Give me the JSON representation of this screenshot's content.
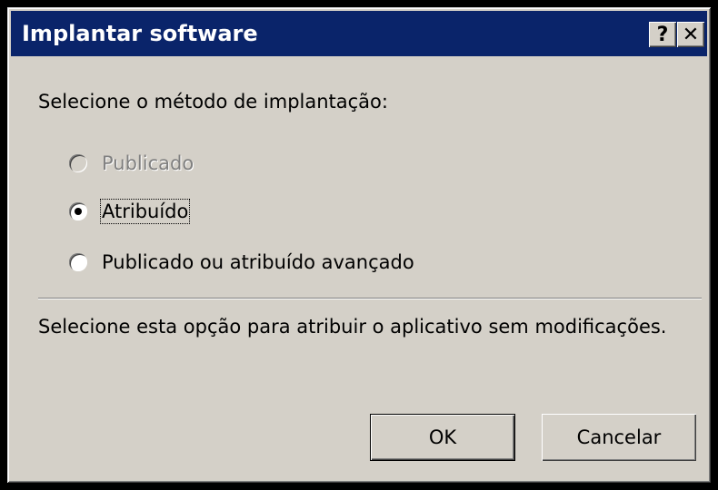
{
  "window": {
    "title": "Implantar software",
    "help_label": "?",
    "close_label": "✕"
  },
  "prompt": "Selecione o método de implantação:",
  "options": [
    {
      "label": "Publicado",
      "selected": false,
      "disabled": true
    },
    {
      "label": "Atribuído",
      "selected": true,
      "disabled": false
    },
    {
      "label": "Publicado ou atribuído avançado",
      "selected": false,
      "disabled": false
    }
  ],
  "description": "Selecione esta opção para atribuir o aplicativo sem modificações.",
  "buttons": {
    "ok_label": "OK",
    "cancel_label": "Cancelar"
  }
}
